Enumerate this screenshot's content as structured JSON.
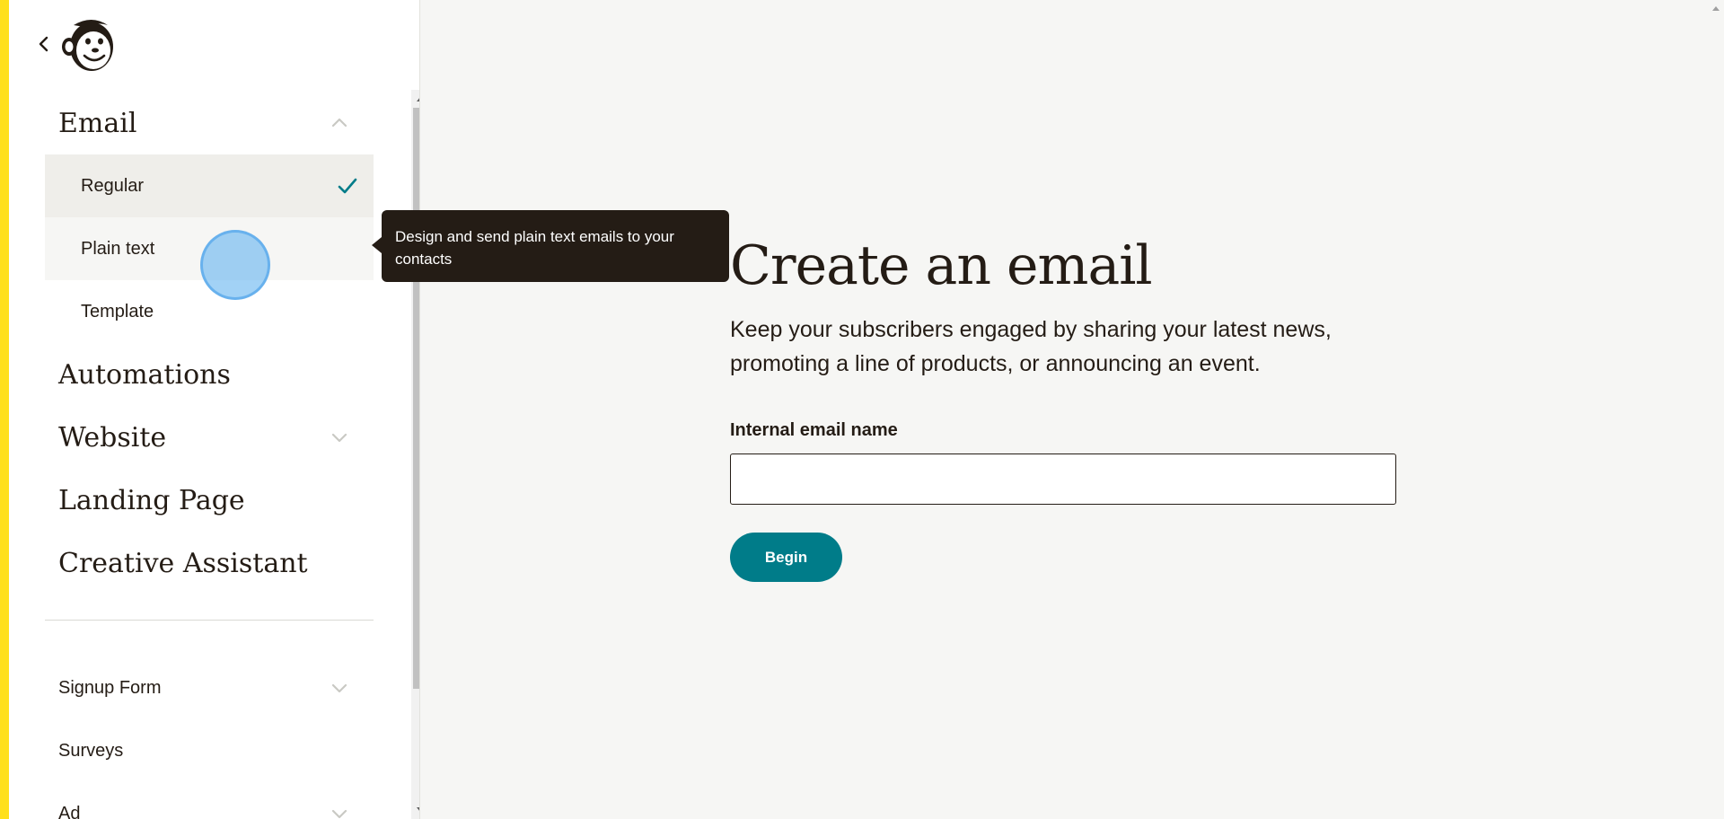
{
  "sidebar": {
    "sections": [
      {
        "label": "Email",
        "expanded": true,
        "items": [
          {
            "label": "Regular",
            "selected": true
          },
          {
            "label": "Plain text",
            "selected": false
          },
          {
            "label": "Template",
            "selected": false
          }
        ]
      },
      {
        "label": "Automations"
      },
      {
        "label": "Website",
        "has_chevron": true
      },
      {
        "label": "Landing Page"
      },
      {
        "label": "Creative Assistant"
      }
    ],
    "lower_items": [
      {
        "label": "Signup Form",
        "has_chevron": true
      },
      {
        "label": "Surveys"
      },
      {
        "label": "Ad",
        "has_chevron": true
      }
    ]
  },
  "tooltip": {
    "text": "Design and send plain text emails to your contacts"
  },
  "main": {
    "title": "Create an email",
    "description": "Keep your subscribers engaged by sharing your latest news, promoting a line of products, or announcing an event.",
    "field_label": "Internal email name",
    "field_value": "",
    "begin_label": "Begin"
  },
  "colors": {
    "accent": "#007c89",
    "brand_yellow": "#ffe01b",
    "text": "#241c15",
    "tooltip_bg": "#241c15"
  },
  "icons": {
    "back": "chevron-left-icon",
    "logo": "mailchimp-freddie-logo",
    "check": "check-icon",
    "chevron_up": "chevron-up-icon",
    "chevron_down": "chevron-down-icon"
  }
}
